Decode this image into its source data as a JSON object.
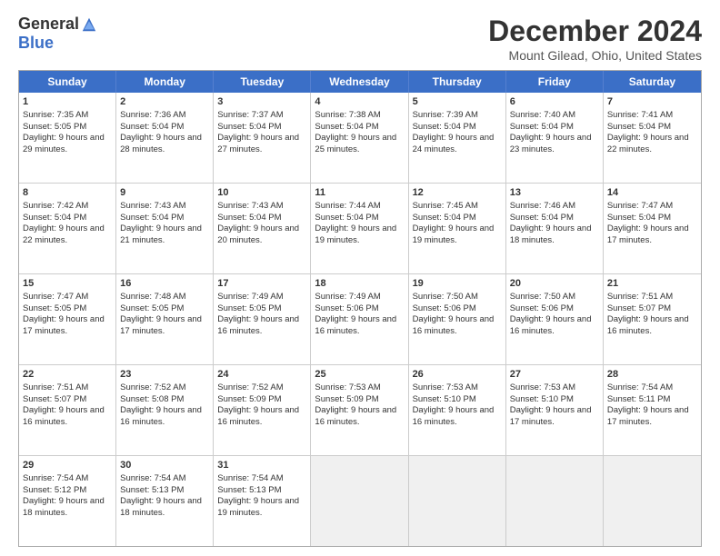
{
  "logo": {
    "general": "General",
    "blue": "Blue"
  },
  "title": "December 2024",
  "location": "Mount Gilead, Ohio, United States",
  "days_of_week": [
    "Sunday",
    "Monday",
    "Tuesday",
    "Wednesday",
    "Thursday",
    "Friday",
    "Saturday"
  ],
  "weeks": [
    [
      {
        "day": "1",
        "sunrise": "Sunrise: 7:35 AM",
        "sunset": "Sunset: 5:05 PM",
        "daylight": "Daylight: 9 hours and 29 minutes."
      },
      {
        "day": "2",
        "sunrise": "Sunrise: 7:36 AM",
        "sunset": "Sunset: 5:04 PM",
        "daylight": "Daylight: 9 hours and 28 minutes."
      },
      {
        "day": "3",
        "sunrise": "Sunrise: 7:37 AM",
        "sunset": "Sunset: 5:04 PM",
        "daylight": "Daylight: 9 hours and 27 minutes."
      },
      {
        "day": "4",
        "sunrise": "Sunrise: 7:38 AM",
        "sunset": "Sunset: 5:04 PM",
        "daylight": "Daylight: 9 hours and 25 minutes."
      },
      {
        "day": "5",
        "sunrise": "Sunrise: 7:39 AM",
        "sunset": "Sunset: 5:04 PM",
        "daylight": "Daylight: 9 hours and 24 minutes."
      },
      {
        "day": "6",
        "sunrise": "Sunrise: 7:40 AM",
        "sunset": "Sunset: 5:04 PM",
        "daylight": "Daylight: 9 hours and 23 minutes."
      },
      {
        "day": "7",
        "sunrise": "Sunrise: 7:41 AM",
        "sunset": "Sunset: 5:04 PM",
        "daylight": "Daylight: 9 hours and 22 minutes."
      }
    ],
    [
      {
        "day": "8",
        "sunrise": "Sunrise: 7:42 AM",
        "sunset": "Sunset: 5:04 PM",
        "daylight": "Daylight: 9 hours and 22 minutes."
      },
      {
        "day": "9",
        "sunrise": "Sunrise: 7:43 AM",
        "sunset": "Sunset: 5:04 PM",
        "daylight": "Daylight: 9 hours and 21 minutes."
      },
      {
        "day": "10",
        "sunrise": "Sunrise: 7:43 AM",
        "sunset": "Sunset: 5:04 PM",
        "daylight": "Daylight: 9 hours and 20 minutes."
      },
      {
        "day": "11",
        "sunrise": "Sunrise: 7:44 AM",
        "sunset": "Sunset: 5:04 PM",
        "daylight": "Daylight: 9 hours and 19 minutes."
      },
      {
        "day": "12",
        "sunrise": "Sunrise: 7:45 AM",
        "sunset": "Sunset: 5:04 PM",
        "daylight": "Daylight: 9 hours and 19 minutes."
      },
      {
        "day": "13",
        "sunrise": "Sunrise: 7:46 AM",
        "sunset": "Sunset: 5:04 PM",
        "daylight": "Daylight: 9 hours and 18 minutes."
      },
      {
        "day": "14",
        "sunrise": "Sunrise: 7:47 AM",
        "sunset": "Sunset: 5:04 PM",
        "daylight": "Daylight: 9 hours and 17 minutes."
      }
    ],
    [
      {
        "day": "15",
        "sunrise": "Sunrise: 7:47 AM",
        "sunset": "Sunset: 5:05 PM",
        "daylight": "Daylight: 9 hours and 17 minutes."
      },
      {
        "day": "16",
        "sunrise": "Sunrise: 7:48 AM",
        "sunset": "Sunset: 5:05 PM",
        "daylight": "Daylight: 9 hours and 17 minutes."
      },
      {
        "day": "17",
        "sunrise": "Sunrise: 7:49 AM",
        "sunset": "Sunset: 5:05 PM",
        "daylight": "Daylight: 9 hours and 16 minutes."
      },
      {
        "day": "18",
        "sunrise": "Sunrise: 7:49 AM",
        "sunset": "Sunset: 5:06 PM",
        "daylight": "Daylight: 9 hours and 16 minutes."
      },
      {
        "day": "19",
        "sunrise": "Sunrise: 7:50 AM",
        "sunset": "Sunset: 5:06 PM",
        "daylight": "Daylight: 9 hours and 16 minutes."
      },
      {
        "day": "20",
        "sunrise": "Sunrise: 7:50 AM",
        "sunset": "Sunset: 5:06 PM",
        "daylight": "Daylight: 9 hours and 16 minutes."
      },
      {
        "day": "21",
        "sunrise": "Sunrise: 7:51 AM",
        "sunset": "Sunset: 5:07 PM",
        "daylight": "Daylight: 9 hours and 16 minutes."
      }
    ],
    [
      {
        "day": "22",
        "sunrise": "Sunrise: 7:51 AM",
        "sunset": "Sunset: 5:07 PM",
        "daylight": "Daylight: 9 hours and 16 minutes."
      },
      {
        "day": "23",
        "sunrise": "Sunrise: 7:52 AM",
        "sunset": "Sunset: 5:08 PM",
        "daylight": "Daylight: 9 hours and 16 minutes."
      },
      {
        "day": "24",
        "sunrise": "Sunrise: 7:52 AM",
        "sunset": "Sunset: 5:09 PM",
        "daylight": "Daylight: 9 hours and 16 minutes."
      },
      {
        "day": "25",
        "sunrise": "Sunrise: 7:53 AM",
        "sunset": "Sunset: 5:09 PM",
        "daylight": "Daylight: 9 hours and 16 minutes."
      },
      {
        "day": "26",
        "sunrise": "Sunrise: 7:53 AM",
        "sunset": "Sunset: 5:10 PM",
        "daylight": "Daylight: 9 hours and 16 minutes."
      },
      {
        "day": "27",
        "sunrise": "Sunrise: 7:53 AM",
        "sunset": "Sunset: 5:10 PM",
        "daylight": "Daylight: 9 hours and 17 minutes."
      },
      {
        "day": "28",
        "sunrise": "Sunrise: 7:54 AM",
        "sunset": "Sunset: 5:11 PM",
        "daylight": "Daylight: 9 hours and 17 minutes."
      }
    ],
    [
      {
        "day": "29",
        "sunrise": "Sunrise: 7:54 AM",
        "sunset": "Sunset: 5:12 PM",
        "daylight": "Daylight: 9 hours and 18 minutes."
      },
      {
        "day": "30",
        "sunrise": "Sunrise: 7:54 AM",
        "sunset": "Sunset: 5:13 PM",
        "daylight": "Daylight: 9 hours and 18 minutes."
      },
      {
        "day": "31",
        "sunrise": "Sunrise: 7:54 AM",
        "sunset": "Sunset: 5:13 PM",
        "daylight": "Daylight: 9 hours and 19 minutes."
      },
      null,
      null,
      null,
      null
    ]
  ]
}
